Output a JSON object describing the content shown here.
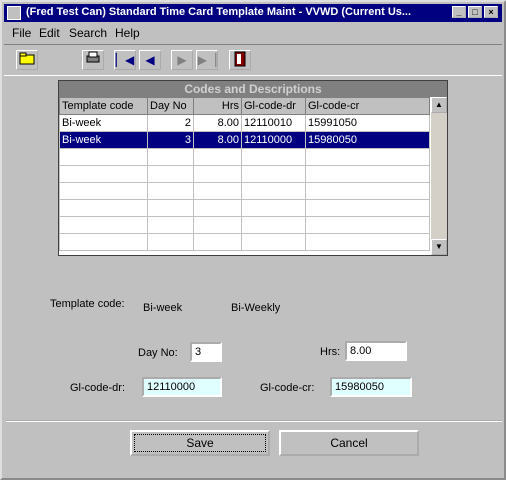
{
  "window": {
    "title": "(Fred Test Can) Standard Time Card Template Maint - VVWD (Current Us..."
  },
  "menu": {
    "file": "File",
    "edit": "Edit",
    "search": "Search",
    "help": "Help"
  },
  "grid": {
    "title": "Codes and Descriptions",
    "columns": [
      "Template code",
      "Day No",
      "Hrs",
      "Gl-code-dr",
      "Gl-code-cr"
    ],
    "rows": [
      [
        "Bi-week",
        "2",
        "8.00",
        "12110010",
        "15991050"
      ],
      [
        "Bi-week",
        "3",
        "8.00",
        "12110000",
        "15980050"
      ]
    ]
  },
  "form": {
    "template_code_label": "Template code:",
    "template_code_value": "Bi-week",
    "template_desc": "Bi-Weekly",
    "day_no_label": "Day No:",
    "day_no_value": "3",
    "hrs_label": "Hrs:",
    "hrs_value": "8.00",
    "gl_dr_label": "Gl-code-dr:",
    "gl_dr_value": "12110000",
    "gl_cr_label": "Gl-code-cr:",
    "gl_cr_value": "15980050"
  },
  "buttons": {
    "save": "Save",
    "cancel": "Cancel"
  },
  "icons": [
    "app-icon",
    "open-folder-icon",
    "print-icon",
    "first-record-icon",
    "prev-record-icon",
    "next-record-icon",
    "last-record-icon",
    "exit-door-icon"
  ]
}
